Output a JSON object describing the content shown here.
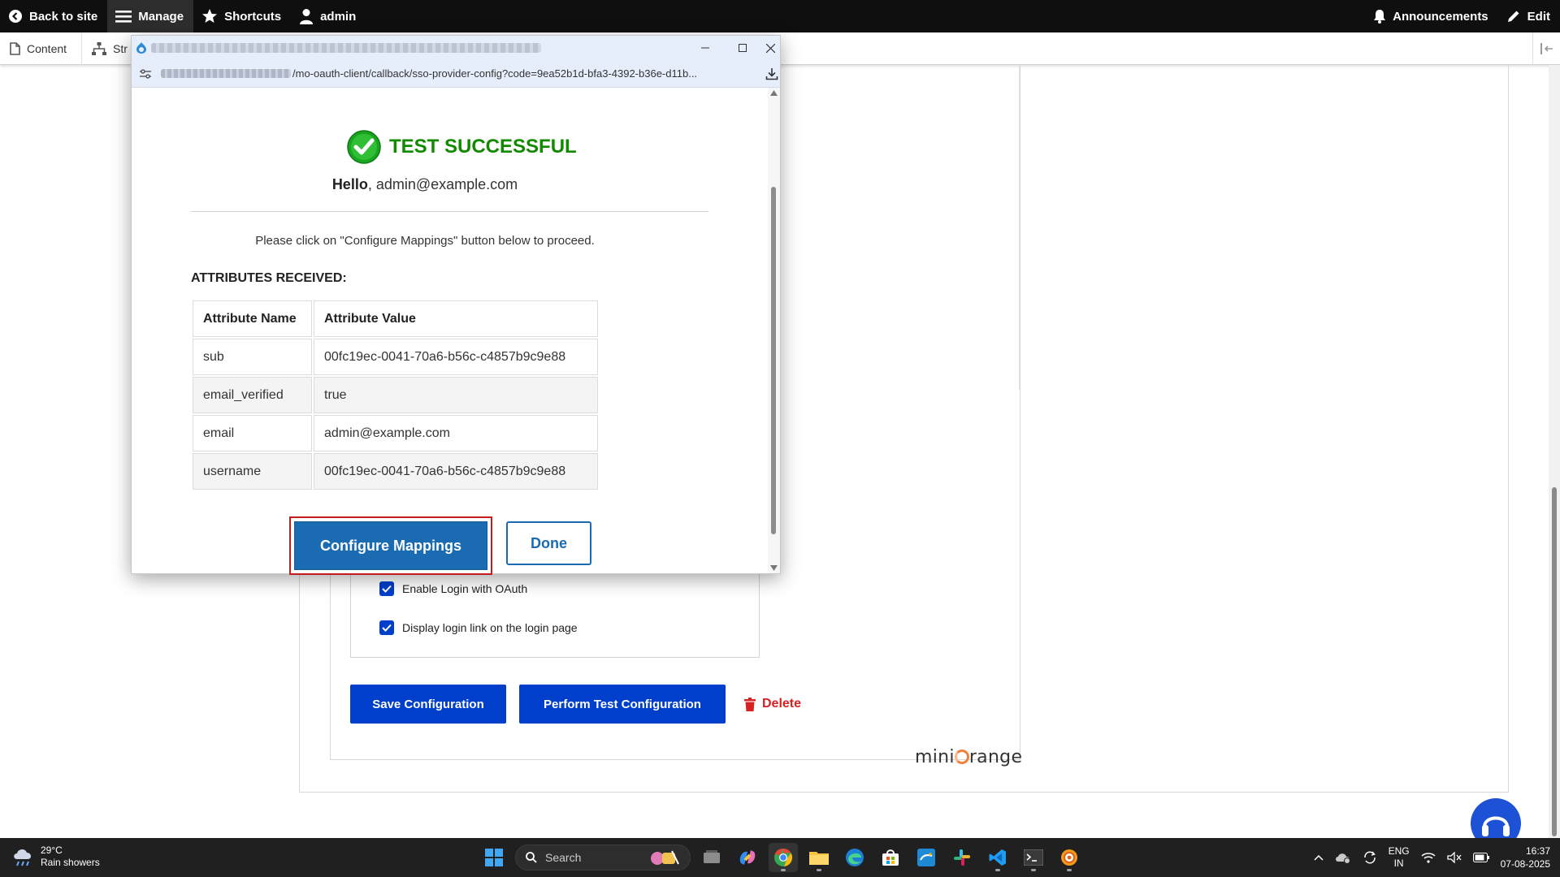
{
  "toolbar": {
    "back_to_site": "Back to site",
    "manage": "Manage",
    "shortcuts": "Shortcuts",
    "user": "admin",
    "announcements": "Announcements",
    "edit": "Edit"
  },
  "tray": {
    "content": "Content",
    "structure": "Str"
  },
  "popup": {
    "url_path": "/mo-oauth-client/callback/sso-provider-config?code=9ea52b1d-bfa3-4392-b36e-d11b...",
    "success_title": "TEST SUCCESSFUL",
    "hello_label": "Hello",
    "hello_email": ", admin@example.com",
    "instruction": "Please click on \"Configure Mappings\" button below to proceed.",
    "attributes_heading": "ATTRIBUTES RECEIVED:",
    "table": {
      "headers": [
        "Attribute Name",
        "Attribute Value"
      ],
      "rows": [
        {
          "name": "sub",
          "value": "00fc19ec-0041-70a6-b56c-c4857b9c9e88"
        },
        {
          "name": "email_verified",
          "value": "true"
        },
        {
          "name": "email",
          "value": "admin@example.com"
        },
        {
          "name": "username",
          "value": "00fc19ec-0041-70a6-b56c-c4857b9c9e88"
        }
      ]
    },
    "configure_button": "Configure Mappings",
    "done_button": "Done"
  },
  "page": {
    "enable_login": "Enable Login with OAuth",
    "display_login_link": "Display login link on the login page",
    "save_button": "Save Configuration",
    "test_button": "Perform Test Configuration",
    "delete_button": "Delete",
    "logo_pre": "mini",
    "logo_post": "range"
  },
  "taskbar": {
    "temperature": "29°C",
    "weather": "Rain showers",
    "search_placeholder": "Search",
    "lang_top": "ENG",
    "lang_bottom": "IN",
    "time": "16:37",
    "date": "07-08-2025"
  },
  "colors": {
    "toolbar_bg": "#0f0f0f",
    "drupal_blue": "#003ecc",
    "success_green": "#128a00",
    "mo_button_blue": "#1a6bb1",
    "highlight_red": "#c41c1c",
    "delete_red": "#d72222"
  }
}
